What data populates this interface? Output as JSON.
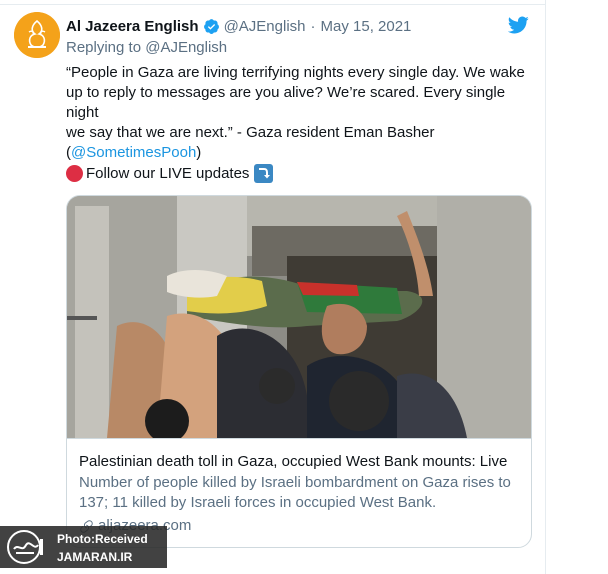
{
  "tweet": {
    "display_name": "Al Jazeera English",
    "handle": "@AJEnglish",
    "separator": "·",
    "date": "May 15, 2021",
    "replying_prefix": "Replying to ",
    "replying_to": "@AJEnglish",
    "text_line1": "“People in Gaza are living terrifying nights every single day. We wake",
    "text_line2": "up to reply to messages are you alive? We’re scared. Every single night",
    "text_line3": "we say that we are next.” - Gaza resident Eman Basher",
    "mention_open": "(",
    "mention": "@SometimesPooh",
    "mention_close": ")",
    "live_text": "Follow our LIVE updates",
    "icons": {
      "verified": "verified-badge-icon",
      "logo": "twitter-bird-icon",
      "red": "red-circle-emoji",
      "arrow": "right-arrow-curving-down-emoji"
    }
  },
  "link_card": {
    "title": "Palestinian death toll in Gaza, occupied West Bank mounts: Live",
    "description": "Number of people killed by Israeli bombardment on Gaza rises to 137; 11 killed by Israeli forces in occupied West Bank.",
    "domain": "aljazeera.com"
  },
  "watermark": {
    "line1": "Photo:Received",
    "line2": "JAMARAN.IR"
  },
  "colors": {
    "link": "#1b95e0",
    "muted": "#5b7083",
    "twitter_blue": "#1da1f2",
    "avatar_bg": "#f4a21a"
  }
}
